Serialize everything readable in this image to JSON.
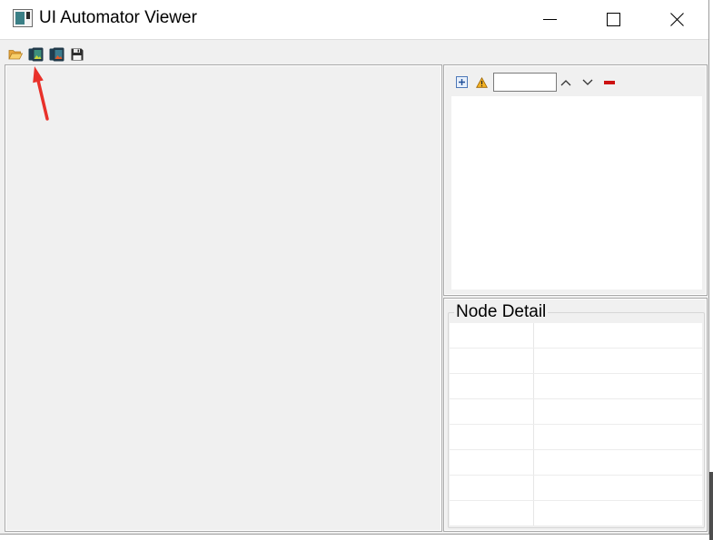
{
  "window": {
    "title": "UI Automator Viewer",
    "icon": "app-window-icon",
    "controls": [
      "minimize-icon",
      "maximize-icon",
      "close-icon"
    ]
  },
  "toolbar": {
    "icons": [
      "folder-open-icon",
      "device-screenshot-icon",
      "device-screenshot-compressed-icon",
      "save-icon"
    ]
  },
  "annotation": {
    "icon": "red-arrow-icon",
    "color": "#e8312a"
  },
  "hierarchy": {
    "toolbar_icons": [
      "expand-all-icon",
      "warning-icon"
    ],
    "search": {
      "value": "",
      "placeholder": ""
    },
    "nav_icons": [
      "chevron-up-icon",
      "chevron-down-icon",
      "clear-search-icon"
    ],
    "tree_items": []
  },
  "node_detail": {
    "title": "Node Detail",
    "rows": [
      {
        "key": "",
        "value": ""
      },
      {
        "key": "",
        "value": ""
      },
      {
        "key": "",
        "value": ""
      },
      {
        "key": "",
        "value": ""
      },
      {
        "key": "",
        "value": ""
      },
      {
        "key": "",
        "value": ""
      },
      {
        "key": "",
        "value": ""
      },
      {
        "key": "",
        "value": ""
      }
    ]
  },
  "colors": {
    "panel_bg": "#f0f0f0",
    "content_bg": "#ffffff",
    "clear_red": "#cc1111",
    "warning": "#f4b223"
  }
}
